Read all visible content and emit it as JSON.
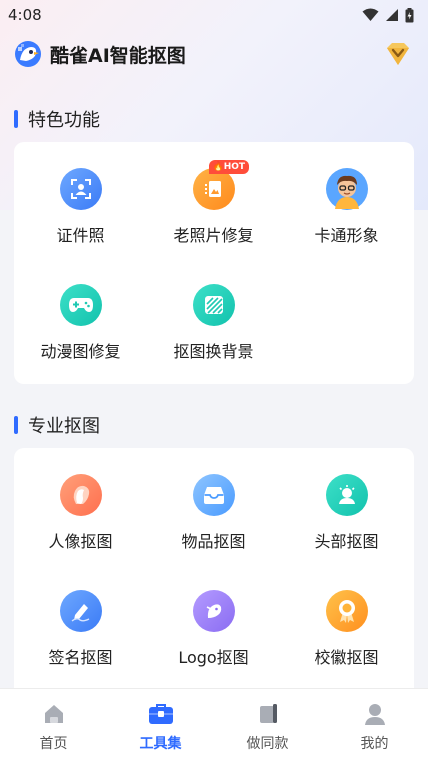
{
  "status_bar": {
    "time": "4:08"
  },
  "header": {
    "title": "酷雀AI智能抠图"
  },
  "colors": {
    "accent": "#2f6bff",
    "hot_badge": "#ff4d3a"
  },
  "featured": {
    "title": "特色功能",
    "items": [
      {
        "label": "证件照",
        "icon": "id-photo-icon"
      },
      {
        "label": "老照片修复",
        "icon": "old-photo-icon",
        "badge": "HOT"
      },
      {
        "label": "卡通形象",
        "icon": "cartoon-avatar-icon"
      },
      {
        "label": "动漫图修复",
        "icon": "gamepad-icon"
      },
      {
        "label": "抠图换背景",
        "icon": "background-swap-icon"
      }
    ]
  },
  "pro": {
    "title": "专业抠图",
    "items": [
      {
        "label": "人像抠图",
        "icon": "portrait-icon"
      },
      {
        "label": "物品抠图",
        "icon": "tray-icon"
      },
      {
        "label": "头部抠图",
        "icon": "head-icon"
      },
      {
        "label": "签名抠图",
        "icon": "pen-icon"
      },
      {
        "label": "Logo抠图",
        "icon": "logo-bird-icon"
      },
      {
        "label": "校徽抠图",
        "icon": "badge-medal-icon"
      }
    ]
  },
  "tabs": [
    {
      "label": "首页",
      "icon": "home-icon",
      "active": false
    },
    {
      "label": "工具集",
      "icon": "toolbox-icon",
      "active": true
    },
    {
      "label": "做同款",
      "icon": "copy-style-icon",
      "active": false
    },
    {
      "label": "我的",
      "icon": "profile-icon",
      "active": false
    }
  ]
}
